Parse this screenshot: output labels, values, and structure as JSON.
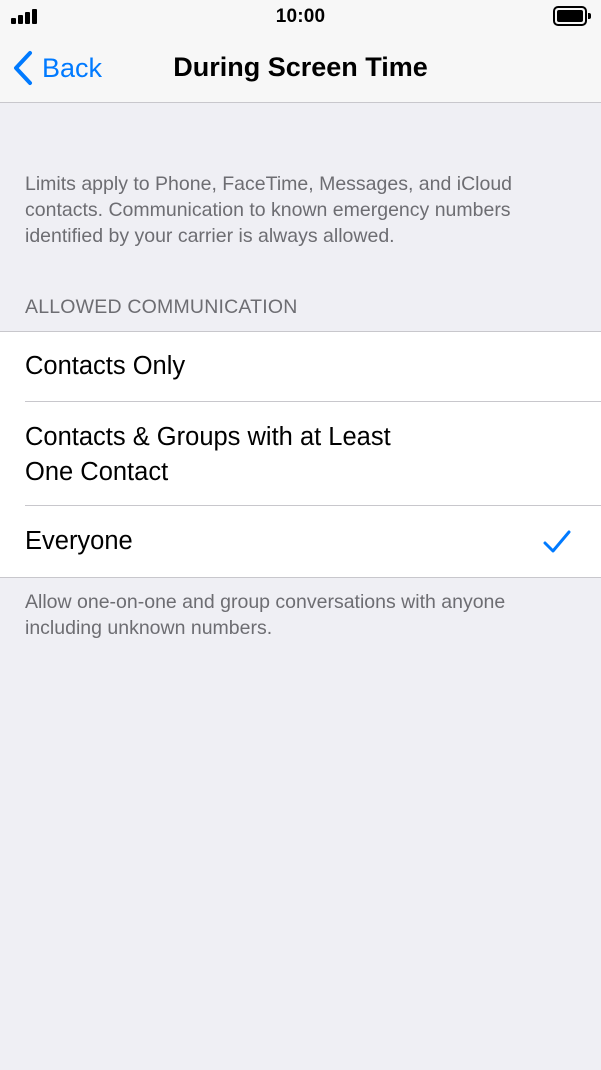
{
  "status_bar": {
    "time": "10:00",
    "signal_icon": "cellular-signal-icon",
    "battery_icon": "battery-full-icon"
  },
  "nav": {
    "back_label": "Back",
    "back_icon": "chevron-left-icon",
    "title": "During Screen Time"
  },
  "info_text": "Limits apply to Phone, FaceTime, Messages, and iCloud contacts. Communication to known emergency numbers identified by your carrier is always allowed.",
  "section_header": "ALLOWED COMMUNICATION",
  "options": [
    {
      "label": "Contacts Only",
      "selected": false
    },
    {
      "label": "Contacts & Groups with at Least One Contact",
      "selected": false
    },
    {
      "label": "Everyone",
      "selected": true
    }
  ],
  "footer_text": "Allow one-on-one and group conversations with anyone including unknown numbers.",
  "colors": {
    "accent": "#007aff",
    "background": "#efeff4",
    "secondary_text": "#6d6d72",
    "separator": "#c8c7cc"
  }
}
